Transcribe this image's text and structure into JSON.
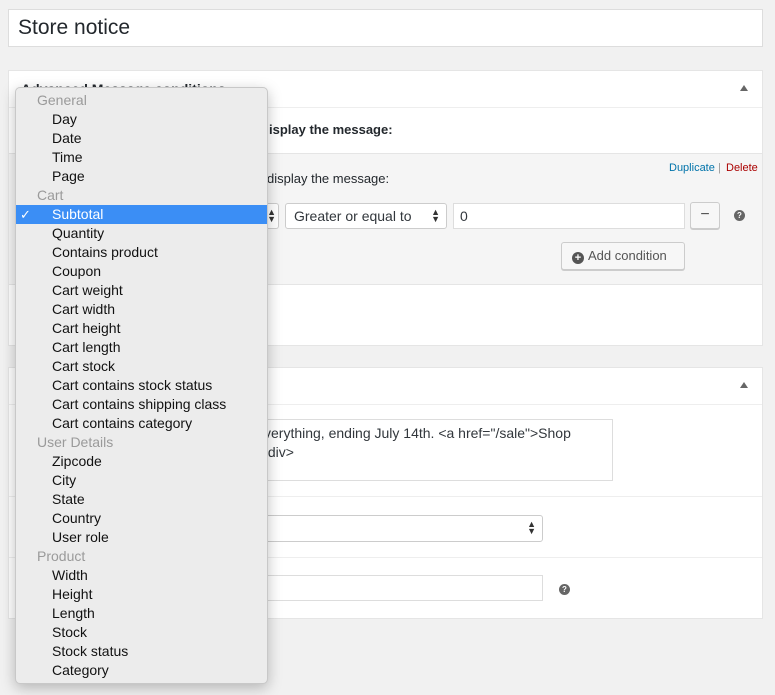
{
  "page": {
    "title": "Store notice"
  },
  "conditions_box": {
    "title": "Advanced Message conditions",
    "intro": "isplay the message:",
    "group_intro": "display the message:",
    "links": {
      "duplicate": "Duplicate",
      "separator": "|",
      "delete": "Delete"
    },
    "condition": {
      "operator": "Greater or equal to",
      "value": "0",
      "remove_label": "−",
      "help": "?"
    },
    "add_condition_label": "Add condition"
  },
  "message_box": {
    "textarea_value": "verything, ending July 14th. <a href=\"/sale\">Shop\n/div>",
    "help": "?"
  },
  "dropdown": {
    "groups": [
      {
        "label": "General",
        "options": [
          "Day",
          "Date",
          "Time",
          "Page"
        ]
      },
      {
        "label": "Cart",
        "options": [
          "Subtotal",
          "Quantity",
          "Contains product",
          "Coupon",
          "Cart weight",
          "Cart width",
          "Cart height",
          "Cart length",
          "Cart stock",
          "Cart contains stock status",
          "Cart contains shipping class",
          "Cart contains category"
        ]
      },
      {
        "label": "User Details",
        "options": [
          "Zipcode",
          "City",
          "State",
          "Country",
          "User role"
        ]
      },
      {
        "label": "Product",
        "options": [
          "Width",
          "Height",
          "Length",
          "Stock",
          "Stock status",
          "Category"
        ]
      }
    ],
    "selected": "Subtotal",
    "check_mark": "✓"
  }
}
